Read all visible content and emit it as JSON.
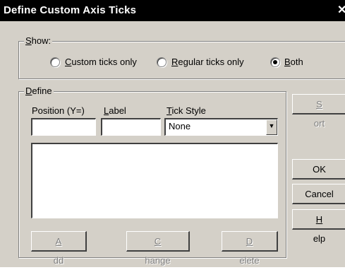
{
  "window": {
    "title": "Define Custom Axis Ticks"
  },
  "show_group": {
    "legend_underlined": "S",
    "legend_rest": "how:",
    "options": [
      {
        "underlined": "C",
        "rest": "ustom ticks only",
        "selected": false
      },
      {
        "underlined": "R",
        "rest": "egular ticks only",
        "selected": false
      },
      {
        "underlined": "B",
        "rest": "oth",
        "selected": true
      }
    ]
  },
  "define_group": {
    "legend_underlined": "D",
    "legend_rest": "efine",
    "position_label": "Position (Y=)",
    "label_label_underlined": "L",
    "label_label_rest": "abel",
    "tick_style_label_underlined": "T",
    "tick_style_label_rest": "ick Style",
    "position_value": "",
    "label_value": "",
    "tick_style_value": "None",
    "buttons": {
      "add": {
        "underlined": "A",
        "rest": "dd"
      },
      "change": {
        "underlined": "C",
        "rest": "hange"
      },
      "delete": {
        "underlined": "D",
        "rest": "elete"
      }
    }
  },
  "side_buttons": {
    "sort": {
      "underlined": "S",
      "rest": "ort"
    },
    "ok": "OK",
    "cancel": "Cancel",
    "help": {
      "underlined": "H",
      "rest": "elp"
    }
  }
}
